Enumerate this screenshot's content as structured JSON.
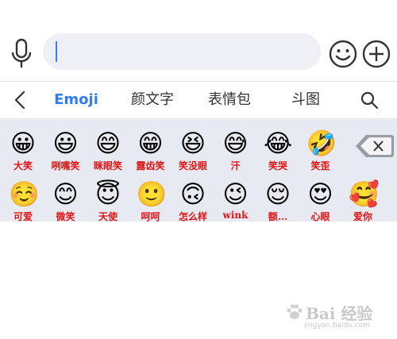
{
  "tabs": [
    {
      "label": "Emoji",
      "active": true
    },
    {
      "label": "颜文字",
      "active": false
    },
    {
      "label": "表情包",
      "active": false
    },
    {
      "label": "斗图",
      "active": false
    }
  ],
  "emoji_rows": [
    [
      {
        "glyph": "😀",
        "label": "大笑"
      },
      {
        "glyph": "😃",
        "label": "咧嘴笑"
      },
      {
        "glyph": "😄",
        "label": "眯眼笑"
      },
      {
        "glyph": "😁",
        "label": "露齿笑"
      },
      {
        "glyph": "😆",
        "label": "笑没眼"
      },
      {
        "glyph": "😅",
        "label": "汗"
      },
      {
        "glyph": "😂",
        "label": "笑哭"
      },
      {
        "glyph": "🤣",
        "label": "笑歪"
      }
    ],
    [
      {
        "glyph": "☺️",
        "label": "可爱"
      },
      {
        "glyph": "😊",
        "label": "微笑"
      },
      {
        "glyph": "😇",
        "label": "天使"
      },
      {
        "glyph": "🙂",
        "label": "呵呵"
      },
      {
        "glyph": "🙃",
        "label": "怎么样"
      },
      {
        "glyph": "😉",
        "label": "wink"
      },
      {
        "glyph": "😌",
        "label": "额..."
      },
      {
        "glyph": "😍",
        "label": "心眼"
      },
      {
        "glyph": "🥰",
        "label": "爱你"
      }
    ]
  ],
  "watermark": {
    "text": "Bai 经验",
    "url": "jingyan.baidu.com"
  },
  "colors": {
    "accent": "#2f7cf6",
    "label": "#e01414",
    "keyboard_bg": "#e8eaf2"
  },
  "icons": [
    "microphone-icon",
    "smiley-icon",
    "plus-icon",
    "back-chevron-icon",
    "search-icon",
    "delete-backspace-icon",
    "baidu-paw-icon"
  ]
}
